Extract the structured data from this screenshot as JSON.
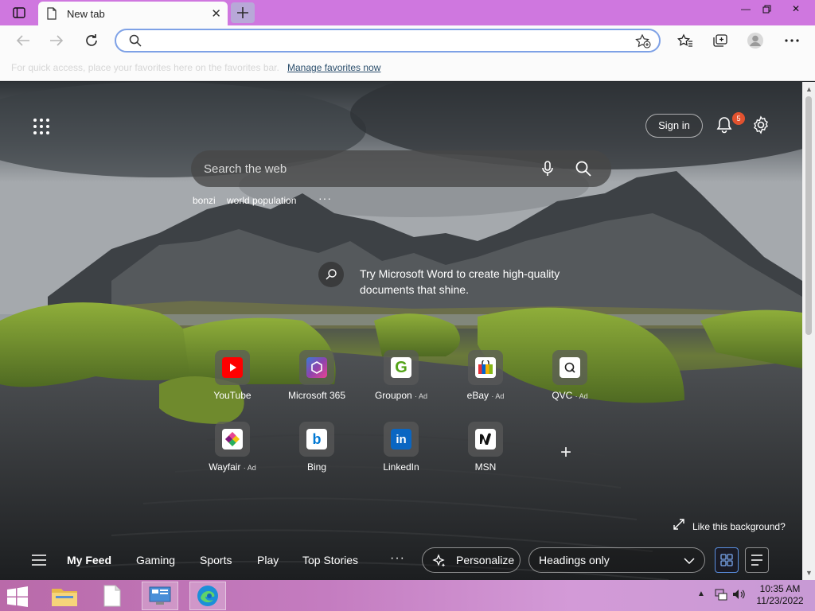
{
  "browser": {
    "tab_title": "New tab",
    "address_value": "",
    "favorites_bar_message": "For quick access, place your favorites here on the favorites bar.",
    "favorites_bar_link": "Manage favorites now"
  },
  "newtab": {
    "sign_in_label": "Sign in",
    "notification_count": "5",
    "search_placeholder": "Search the web",
    "suggestions": [
      "bonzi",
      "world population"
    ],
    "suggestions_more": "···",
    "promo_text": "Try Microsoft Word to create high-quality documents that shine.",
    "tiles": [
      {
        "label": "YouTube",
        "ad": "",
        "icon": "youtube-icon",
        "color": "#ff0000"
      },
      {
        "label": "Microsoft 365",
        "ad": "",
        "icon": "microsoft-365-icon",
        "color": "#6b4fd8"
      },
      {
        "label": "Groupon",
        "ad": "· Ad",
        "icon": "groupon-icon",
        "color": "#53a318"
      },
      {
        "label": "eBay",
        "ad": "· Ad",
        "icon": "ebay-icon",
        "color": "#e53238"
      },
      {
        "label": "QVC",
        "ad": "· Ad",
        "icon": "qvc-icon",
        "color": "#ffffff"
      },
      {
        "label": "Wayfair",
        "ad": "· Ad",
        "icon": "wayfair-icon",
        "color": "#7f187f"
      },
      {
        "label": "Bing",
        "ad": "",
        "icon": "bing-icon",
        "color": "#0078d4"
      },
      {
        "label": "LinkedIn",
        "ad": "",
        "icon": "linkedin-icon",
        "color": "#0a66c2"
      },
      {
        "label": "MSN",
        "ad": "",
        "icon": "msn-icon",
        "color": "#ffffff"
      }
    ],
    "like_background": "Like this background?",
    "feed_tabs": [
      "My Feed",
      "Gaming",
      "Sports",
      "Play",
      "Top Stories"
    ],
    "feed_more": "···",
    "personalize_label": "Personalize",
    "headings_select": "Headings only"
  },
  "taskbar": {
    "time": "10:35 AM",
    "date": "11/23/2022"
  }
}
